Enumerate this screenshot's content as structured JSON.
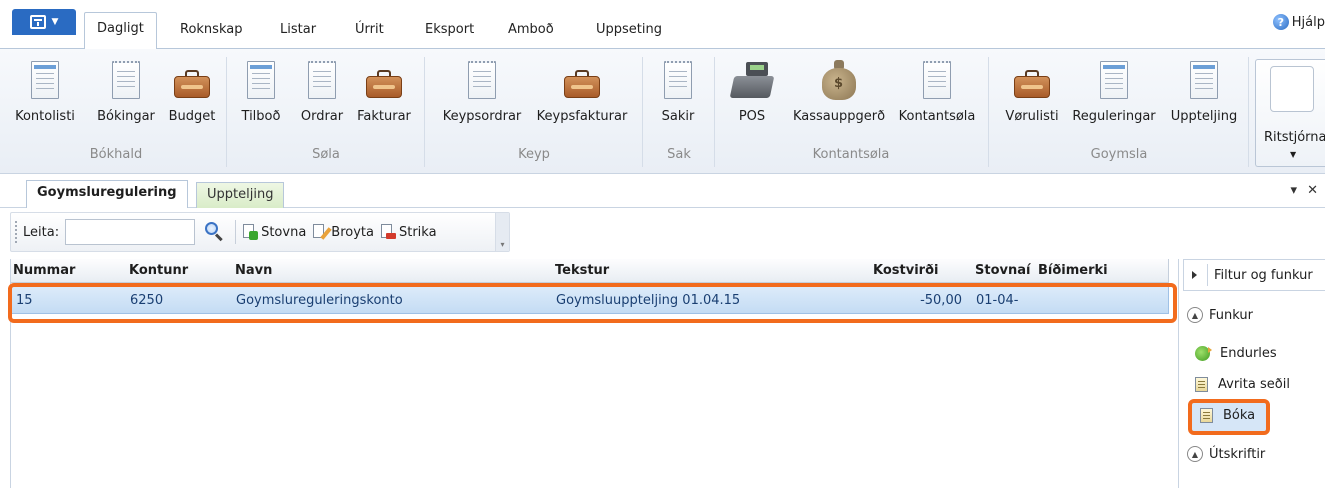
{
  "ribbon_tabs": [
    "Dagligt",
    "Roknskap",
    "Listar",
    "Úrrit",
    "Eksport",
    "Amboð",
    "Uppseting"
  ],
  "help_label": "Hjálp",
  "ribbon": {
    "buttons": [
      {
        "label": "Kontolisti",
        "icon": "ledger-icon"
      },
      {
        "label": "Bókingar",
        "icon": "receipt-icon"
      },
      {
        "label": "Budget",
        "icon": "briefcase-icon"
      },
      {
        "label": "Tilboð",
        "icon": "ledger-icon"
      },
      {
        "label": "Ordrar",
        "icon": "receipt-icon"
      },
      {
        "label": "Fakturar",
        "icon": "briefcase-icon"
      },
      {
        "label": "Keypsordrar",
        "icon": "receipt-icon"
      },
      {
        "label": "Keypsfakturar",
        "icon": "briefcase-icon"
      },
      {
        "label": "Sakir",
        "icon": "receipt-icon"
      },
      {
        "label": "POS",
        "icon": "cash-register-icon"
      },
      {
        "label": "Kassauppgerð",
        "icon": "money-bag-icon"
      },
      {
        "label": "Kontantsøla",
        "icon": "receipt-icon"
      },
      {
        "label": "Vørulisti",
        "icon": "briefcase-icon"
      },
      {
        "label": "Reguleringar",
        "icon": "ledger-icon"
      },
      {
        "label": "Uppteljing",
        "icon": "ledger-icon"
      }
    ],
    "groups": [
      "Bókhald",
      "Søla",
      "Keyp",
      "Sak",
      "Kontantsøla",
      "Goymsla"
    ],
    "editor_button": "Ritstjórna"
  },
  "doc_tabs": [
    "Goymsluregulering",
    "Uppteljing"
  ],
  "doc_tab_controls": "▾ ✕",
  "toolbar": {
    "search_label": "Leita:",
    "search_value": "",
    "create": "Stovna",
    "edit": "Broyta",
    "delete": "Strika"
  },
  "grid": {
    "columns": [
      "Nummar",
      "Kontunr",
      "Navn",
      "Tekstur",
      "Kostvirði",
      "Stovnað",
      "Bíðimerki"
    ],
    "columns_display": [
      "Nummar",
      "Kontunr",
      "Navn",
      "Tekstur",
      "Kostvirði",
      "Stovnaí",
      "Bíðimerki"
    ],
    "rows": [
      {
        "nummar": "15",
        "kontunr": "6250",
        "navn": "Goymslureguleringskonto",
        "tekstur": "Goymsluuppteljing 01.04.15",
        "kostvirdi": "-50,00",
        "stovnad": "01-04-",
        "bidimerki": ""
      }
    ]
  },
  "panel": {
    "header": "Filtur og funkur",
    "section_functions": "Funkur",
    "items": [
      "Endurles",
      "Avrita seðil",
      "Bóka"
    ],
    "section_reports": "Útskriftir"
  },
  "colors": {
    "accent": "#2a6bc2",
    "highlight": "#f26b1d",
    "row_selected": "#c4dcf4"
  }
}
